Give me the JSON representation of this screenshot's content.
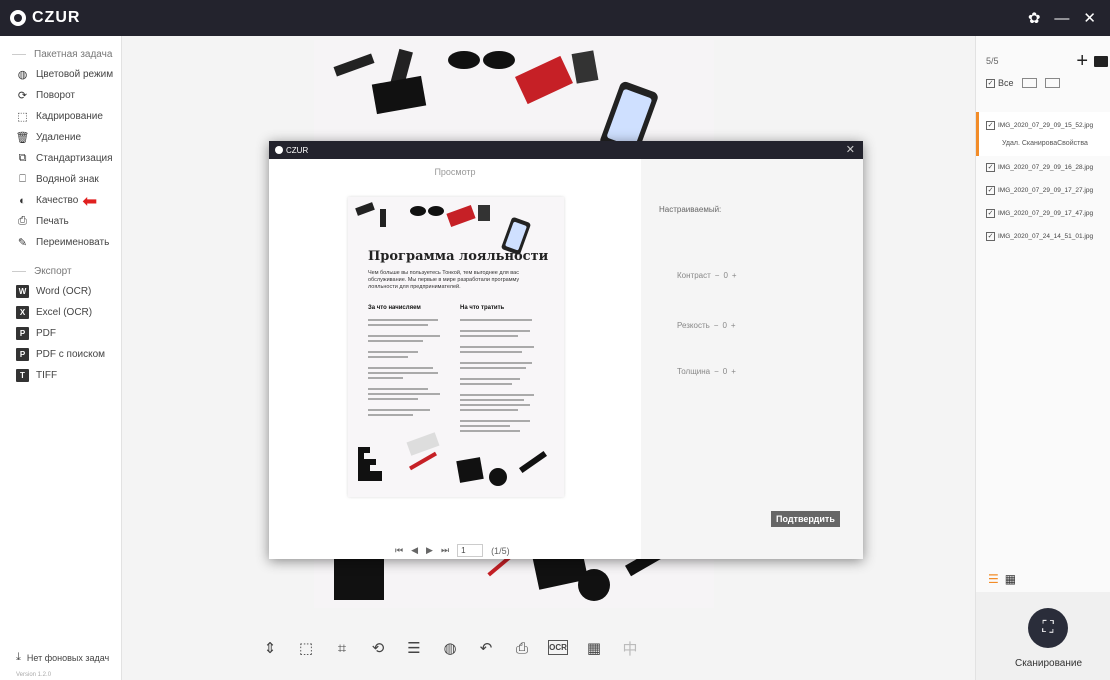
{
  "app": {
    "logo_text": "CZUR",
    "controls": {
      "settings": "✿",
      "minimize": "—",
      "close": "✕"
    }
  },
  "sidebar": {
    "batch_header": "Пакетная задача",
    "batch_items": [
      {
        "label": "Цветовой режим",
        "icon": "◍"
      },
      {
        "label": "Поворот",
        "icon": "⟳"
      },
      {
        "label": "Кадрирование",
        "icon": "⬚"
      },
      {
        "label": "Удаление",
        "icon": "🗑"
      },
      {
        "label": "Стандартизация",
        "icon": "⧉"
      },
      {
        "label": "Водяной знак",
        "icon": "⎕"
      },
      {
        "label": "Качество",
        "icon": "◐"
      },
      {
        "label": "Печать",
        "icon": "⎙"
      },
      {
        "label": "Переименовать",
        "icon": "✎"
      }
    ],
    "export_header": "Экспорт",
    "export_items": [
      {
        "label": "Word (OCR)",
        "icon": "W"
      },
      {
        "label": "Excel (OCR)",
        "icon": "X"
      },
      {
        "label": "PDF",
        "icon": "P"
      },
      {
        "label": "PDF с поиском",
        "icon": "P"
      },
      {
        "label": "TIFF",
        "icon": "T"
      }
    ],
    "bottom_status": "Нет фоновых задач",
    "version": "Version 1.2.0"
  },
  "right_panel": {
    "count": "5/5",
    "all_label": "Все",
    "files": [
      "IMG_2020_07_29_09_15_52.jpg",
      "IMG_2020_07_29_09_16_28.jpg",
      "IMG_2020_07_29_09_17_27.jpg",
      "IMG_2020_07_29_09_17_47.jpg",
      "IMG_2020_07_24_14_51_01.jpg"
    ],
    "active_actions": "Удал.  СканироваСвойства",
    "scan_label": "Сканирование"
  },
  "modal": {
    "title": "CZUR",
    "preview_label": "Просмотр",
    "doc": {
      "title": "Программа лояльности",
      "intro": "Чем больше вы пользуетесь Тонкой, тем выгоднее для вас обслуживание. Мы первые в мире разработали программу лояльности для предпринимателей.",
      "col1_title": "За что начисляем",
      "col2_title": "На что тратить"
    },
    "custom_label": "Настраиваемый:",
    "params": [
      {
        "label": "Контраст",
        "value": "0"
      },
      {
        "label": "Резкость",
        "value": "0"
      },
      {
        "label": "Толщина",
        "value": "0"
      }
    ],
    "confirm": "Подтвердить",
    "page_value": "1",
    "page_info": "(1/5)"
  },
  "colors": {
    "titlebar": "#23232d",
    "accent": "#f28c28",
    "arrow": "#e0201f"
  }
}
